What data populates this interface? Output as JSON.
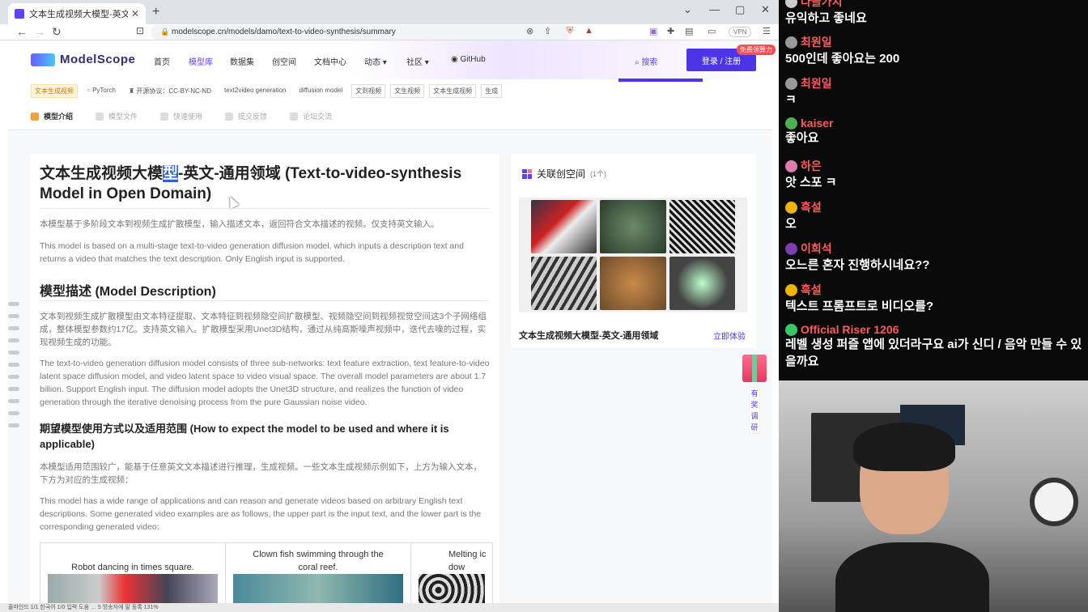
{
  "browser": {
    "tab_title": "文本生成视频大模型-英文-通用领",
    "tab_close": "✕",
    "new_tab": "+",
    "win_min": "—",
    "win_max": "▢",
    "win_close": "✕",
    "url": "modelscope.cn/models/damo/text-to-video-synthesis/summary",
    "vpn": "VPN"
  },
  "site": {
    "logo": "ModelScope",
    "menu": [
      "首页",
      "模型库",
      "数据集",
      "创空间",
      "文档中心",
      "动态 ▾",
      "社区 ▾"
    ],
    "github": "GitHub",
    "search": "搜索",
    "login": "登录 / 注册",
    "free_badge": "免费领算力"
  },
  "tags": [
    "文本生成视频",
    "PyTorch",
    "开源协议：CC-BY-NC-ND",
    "text2video generation",
    "diffusion model",
    "文到视频",
    "文生视频",
    "文本生成视频",
    "生成"
  ],
  "subtabs": [
    "模型介绍",
    "模型文件",
    "快速使用",
    "提交反馈",
    "论坛交流"
  ],
  "content": {
    "title_a": "文本生成视频大模",
    "title_sel": "型",
    "title_b": "-英文-通用领域 (Text-to-video-synthesis Model in Open Domain)",
    "intro_cn": "本模型基于多阶段文本到视频生成扩散模型，输入描述文本，返回符合文本描述的视频。仅支持英文输入。",
    "intro_en": "This model is based on a multi-stage text-to-video generation diffusion model, which inputs a description text and returns a video that matches the text description. Only English input is supported.",
    "h_desc": "模型描述 (Model Description)",
    "desc_cn": "文本到视频生成扩散模型由文本特征提取、文本特征到视频隐空间扩散模型、视频隐空间到视频视觉空间这3个子网络组成，整体模型参数约17亿。支持英文输入。扩散模型采用Unet3D结构，通过从纯高斯噪声视频中，迭代去噪的过程，实现视频生成的功能。",
    "desc_en": "The text-to-video generation diffusion model consists of three sub-networks: text feature extraction, text feature-to-video latent space diffusion model, and video latent space to video visual space. The overall model parameters are about 1.7 billion. Support English input. The diffusion model adopts the Unet3D structure, and realizes the function of video generation through the iterative denoising process from the pure Gaussian noise video.",
    "h_use": "期望模型使用方式以及适用范围 (How to expect the model to be used and where it is applicable)",
    "use_cn": "本模型适用范围较广，能基于任意英文文本描述进行推理，生成视频。一些文本生成视频示例如下，上方为输入文本，下方为对应的生成视频：",
    "use_en": "This model has a wide range of applications and can reason and generate videos based on arbitrary English text descriptions. Some generated video examples are as follows, the upper part is the input text, and the lower part is the corresponding generated video:",
    "examples": [
      "Robot dancing in times square.",
      "Clown fish swimming through the coral reef.",
      "Melting ic dow"
    ]
  },
  "related": {
    "title": "关联创空间",
    "count": "(1个)",
    "name": "文本生成视频大模型-英文-通用领域",
    "link": "立即体验"
  },
  "survey": "有奖调研",
  "statusbar": "줄마인드 1/1    한국어    1/0 입력 도움    …    5 방송자에 말 등록    131%",
  "chat": [
    {
      "user": "다을가치",
      "color": "#ff5b5b",
      "avatar": "#ccc",
      "msg": "유익하고 좋네요"
    },
    {
      "user": "최원일",
      "color": "#ff5b5b",
      "avatar": "#999",
      "msg": "500인데 좋아요는 200"
    },
    {
      "user": "최원일",
      "color": "#ff5b5b",
      "avatar": "#999",
      "msg": "ㅋ"
    },
    {
      "user": "kaiser",
      "color": "#ff5b5b",
      "avatar": "#4caf50",
      "msg": "좋아요"
    },
    {
      "user": "하은",
      "color": "#ff5b5b",
      "avatar": "#e07bb0",
      "msg": "앗 스포 ㅋ"
    },
    {
      "user": "흑설",
      "color": "#ff5b5b",
      "avatar": "#f0b400",
      "msg": "오"
    },
    {
      "user": "이희석",
      "color": "#ff5b5b",
      "avatar": "#7b3fb3",
      "msg": "오느른 혼자 진행하시네요??"
    },
    {
      "user": "흑설",
      "color": "#ff5b5b",
      "avatar": "#f0b400",
      "msg": "텍스트 프롬프트로 비디오를?"
    },
    {
      "user": "Official Riser 1206",
      "color": "#ff5b5b",
      "avatar": "#37c76a",
      "msg": "레벨 생성 퍼즐 앱에 있더라구요 ai가 신디 / 음악 만들 수 있을까요"
    }
  ]
}
